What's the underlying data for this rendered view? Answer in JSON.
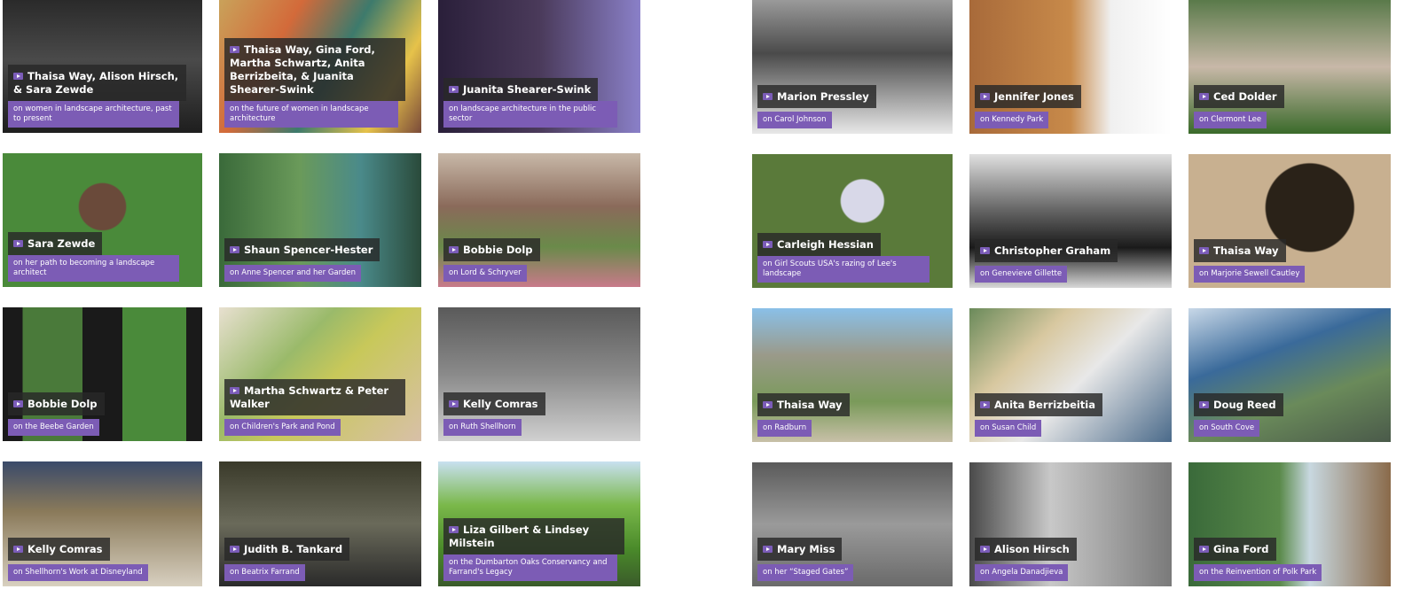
{
  "colors": {
    "accent": "#7c5cb5",
    "overlay": "#282828"
  },
  "left": [
    {
      "name": "Thaisa Way, Alison Hirsch, & Sara Zewde",
      "sub": "on women in landscape architecture, past to present"
    },
    {
      "name": "Thaisa Way, Gina Ford, Martha Schwartz, Anita Berrizbeita, & Juanita Shearer-Swink",
      "sub": "on the future of women in landscape architecture"
    },
    {
      "name": "Juanita Shearer-Swink",
      "sub": "on landscape architecture in the public sector"
    },
    {
      "name": "Sara Zewde",
      "sub": "on her path to becoming a landscape architect"
    },
    {
      "name": "Shaun Spencer-Hester",
      "sub": "on Anne Spencer and her Garden"
    },
    {
      "name": "Bobbie Dolp",
      "sub": "on Lord & Schryver"
    },
    {
      "name": "Bobbie Dolp",
      "sub": "on the Beebe Garden"
    },
    {
      "name": "Martha Schwartz & Peter Walker",
      "sub": "on Children's Park and Pond"
    },
    {
      "name": "Kelly Comras",
      "sub": "on Ruth Shellhorn"
    },
    {
      "name": "Kelly Comras",
      "sub": "on Shellhorn's Work at Disneyland"
    },
    {
      "name": "Judith B. Tankard",
      "sub": "on Beatrix Farrand"
    },
    {
      "name": "Liza Gilbert & Lindsey Milstein",
      "sub": "on the Dumbarton Oaks Conservancy and Farrand's Legacy"
    }
  ],
  "right": [
    {
      "name": "Marion Pressley",
      "sub": "on Carol Johnson"
    },
    {
      "name": "Jennifer Jones",
      "sub": "on Kennedy Park"
    },
    {
      "name": "Ced Dolder",
      "sub": "on Clermont Lee"
    },
    {
      "name": "Carleigh Hessian",
      "sub": "on Girl Scouts USA's razing of Lee's landscape"
    },
    {
      "name": "Christopher Graham",
      "sub": "on Genevieve Gillette"
    },
    {
      "name": "Thaisa Way",
      "sub": "on Marjorie Sewell Cautley"
    },
    {
      "name": "Thaisa Way",
      "sub": "on Radburn"
    },
    {
      "name": "Anita Berrizbeitia",
      "sub": "on Susan Child"
    },
    {
      "name": "Doug Reed",
      "sub": "on South Cove"
    },
    {
      "name": "Mary Miss",
      "sub": "on her “Staged Gates”"
    },
    {
      "name": "Alison Hirsch",
      "sub": "on Angela Danadjieva"
    },
    {
      "name": "Gina Ford",
      "sub": "on the Reinvention of Polk Park"
    }
  ]
}
